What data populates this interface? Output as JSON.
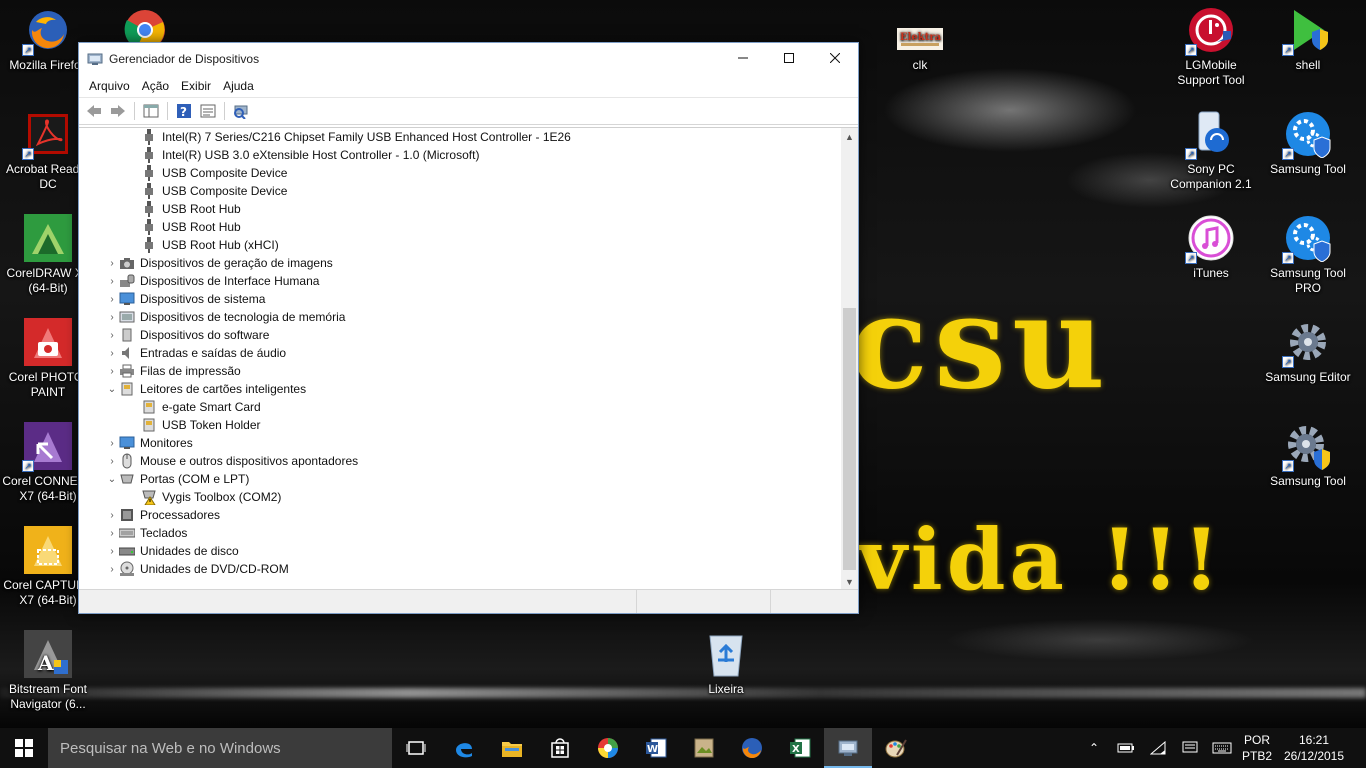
{
  "wallpaper": {
    "text_large": "csu",
    "text_small": "vida !!!"
  },
  "desktop_icons": {
    "firefox": "Mozilla Firefox",
    "chrome": "",
    "acrobat": "Acrobat Reader DC",
    "coreldraw": "CorelDRAW X7 (64-Bit)",
    "photopaint": "Corel PHOTO-PAINT",
    "connect": "Corel CONNECT X7 (64-Bit)",
    "capture": "Corel CAPTURE X7 (64-Bit)",
    "bitstream": "Bitstream Font Navigator (6...",
    "clk": "clk",
    "lgmobile": "LGMobile Support Tool",
    "shell": "shell",
    "sony": "Sony PC Companion 2.1",
    "samsung1": "Samsung Tool",
    "itunes": "iTunes",
    "samsung_pro": "Samsung Tool PRO",
    "samsung_editor": "Samsung Editor",
    "samsung2": "Samsung Tool",
    "recycle": "Lixeira"
  },
  "window": {
    "title": "Gerenciador de Dispositivos",
    "menu": [
      "Arquivo",
      "Ação",
      "Exibir",
      "Ajuda"
    ],
    "tree": [
      "Intel(R) 7 Series/C216 Chipset Family USB Enhanced Host Controller - 1E26",
      "Intel(R) USB 3.0 eXtensible Host Controller - 1.0 (Microsoft)",
      "USB Composite Device",
      "USB Composite Device",
      "USB Root Hub",
      "USB Root Hub",
      "USB Root Hub (xHCI)",
      "Dispositivos de geração de imagens",
      "Dispositivos de Interface Humana",
      "Dispositivos de sistema",
      "Dispositivos de tecnologia de memória",
      "Dispositivos do software",
      "Entradas e saídas de áudio",
      "Filas de impressão",
      "Leitores de cartões inteligentes",
      "e-gate Smart Card",
      "USB Token Holder",
      "Monitores",
      "Mouse e outros dispositivos apontadores",
      "Portas (COM e LPT)",
      "Vygis Toolbox (COM2)",
      "Processadores",
      "Teclados",
      "Unidades de disco",
      "Unidades de DVD/CD-ROM"
    ]
  },
  "taskbar": {
    "search_placeholder": "Pesquisar na Web e no Windows",
    "lang_line1": "POR",
    "lang_line2": "PTB2",
    "time": "16:21",
    "date": "26/12/2015"
  },
  "colors": {
    "accent": "#76b9ed",
    "wallpaper_text": "#f4d10a"
  }
}
